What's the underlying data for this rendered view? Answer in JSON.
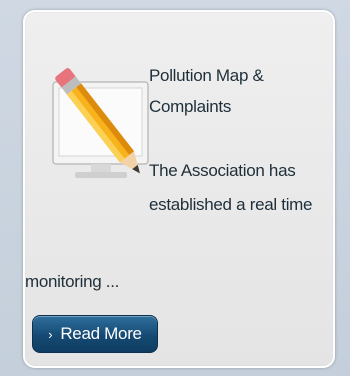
{
  "card": {
    "title_line1": "Pollution Map &",
    "title_line2": "Complaints",
    "desc_line1": "The Association has",
    "desc_line2": "established a real time",
    "desc_line3": "monitoring ...",
    "button_label": "Read More",
    "button_chevron": "›",
    "icon": "pencil-monitor-icon"
  },
  "colors": {
    "button": "#154a73",
    "text": "#1f2f3a",
    "card_bg": "#ececec"
  }
}
